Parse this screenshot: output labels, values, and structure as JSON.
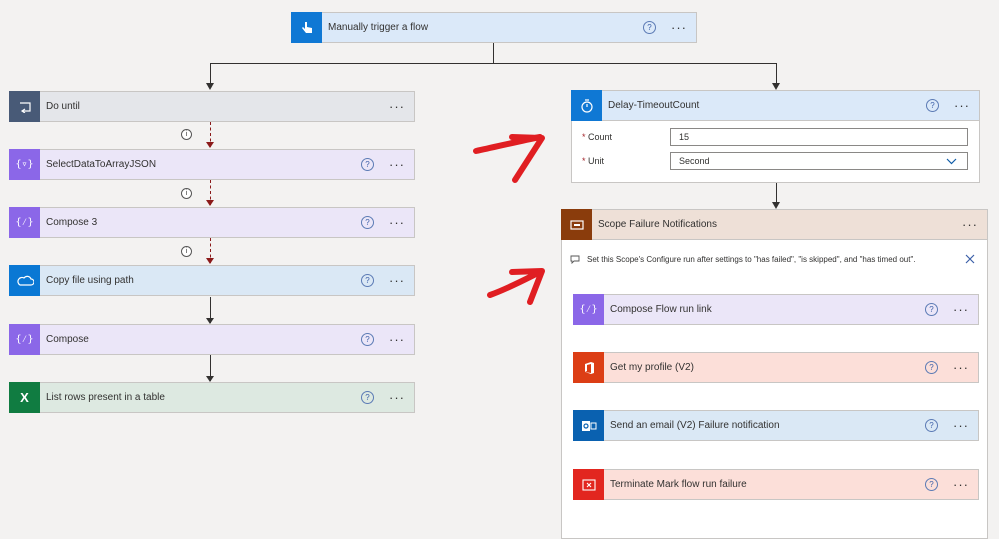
{
  "trigger": {
    "title": "Manually trigger a flow"
  },
  "left_steps": [
    {
      "title": "Do until"
    },
    {
      "title": "SelectDataToArrayJSON"
    },
    {
      "title": "Compose 3"
    },
    {
      "title": "Copy file using path"
    },
    {
      "title": "Compose"
    },
    {
      "title": "List rows present in a table"
    }
  ],
  "delay": {
    "title": "Delay-TimeoutCount",
    "count_label": "Count",
    "count_value": "15",
    "unit_label": "Unit",
    "unit_value": "Second"
  },
  "scope": {
    "title": "Scope Failure Notifications",
    "notice": "Set this Scope's Configure run after settings to \"has failed\", \"is skipped\", and \"has timed out\".",
    "steps": [
      {
        "title": "Compose Flow run link"
      },
      {
        "title": "Get my profile (V2)"
      },
      {
        "title": "Send an email (V2) Failure notification"
      },
      {
        "title": "Terminate Mark flow run failure"
      }
    ]
  },
  "glyphs": {
    "help": "?",
    "more": "···",
    "info": "i",
    "required": "*"
  },
  "colors": {
    "trigger_bg": "#dbe9f9",
    "trigger_icon": "#0f78d4",
    "dountil_bg": "#e4e6ea",
    "dountil_icon": "#485a77",
    "variable_bg": "#ebe6f8",
    "variable_icon": "#8b67e8",
    "onedrive_bg": "#dae8f5",
    "onedrive_icon": "#0a78d4",
    "excel_bg": "#dde9e1",
    "excel_icon": "#107c41",
    "scope_bg": "#eee0d7",
    "scope_icon": "#8a3c0c",
    "office_bg": "#fcdfd9",
    "office_icon": "#dc3e15",
    "outlook_bg": "#dae8f5",
    "outlook_icon": "#0a61b0",
    "terminate_bg": "#fcdfd9",
    "terminate_icon": "#e2261f",
    "annotation": "#e01e22"
  }
}
